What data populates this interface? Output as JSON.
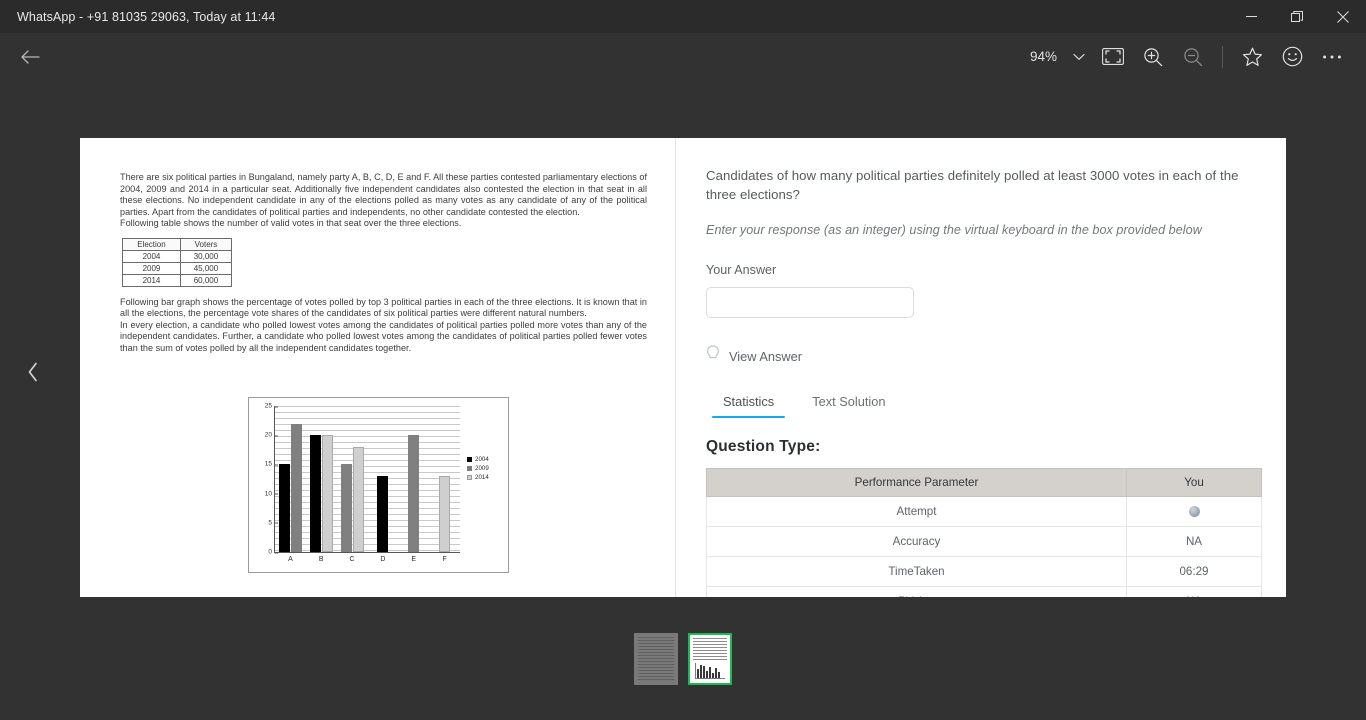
{
  "window": {
    "title": "WhatsApp - +91 81035 29063, Today at 11:44",
    "minimize_label": "Minimize",
    "restore_label": "Restore",
    "close_label": "Close"
  },
  "toolbar": {
    "back_label": "Back",
    "zoom_level": "94%",
    "zoom_dropdown_label": "Zoom options",
    "fit_label": "Fit to window",
    "zoom_in_label": "Zoom in",
    "zoom_out_label": "Zoom out",
    "favorite_label": "Add to favorites",
    "emoji_label": "React",
    "more_label": "More options"
  },
  "navigation": {
    "prev_label": "Previous"
  },
  "document": {
    "paragraph1": "There are six political parties in Bungaland, namely party A, B, C, D, E and F. All these parties contested parliamentary elections of 2004, 2009 and 2014 in a particular seat. Additionally five independent candidates also contested the election in that seat in all these elections. No independent candidate in any of the elections polled as many votes as any candidate of any of the political parties. Apart from the candidates of political parties and independents, no other candidate contested the election.",
    "paragraph1_last_line": "Following table shows the number of valid votes in that seat over the three elections.",
    "table": {
      "headers": [
        "Election",
        "Voters"
      ],
      "rows": [
        [
          "2004",
          "30,000"
        ],
        [
          "2009",
          "45,000"
        ],
        [
          "2014",
          "60,000"
        ]
      ]
    },
    "paragraph2": "Following bar graph shows the percentage of votes polled by top 3 political parties in each of the three elections.  It is known that in all the elections, the percentage vote shares of the candidates of six political parties were different natural numbers.",
    "paragraph3": "In every election, a candidate who polled lowest votes among the candidates of political parties polled more votes than any of the independent candidates.  Further, a candidate who polled lowest votes among the candidates of political parties polled fewer votes than the sum of votes polled by all the independent candidates together."
  },
  "chart_data": {
    "type": "bar",
    "title": "",
    "xlabel": "",
    "ylabel": "",
    "categories": [
      "A",
      "B",
      "C",
      "D",
      "E",
      "F"
    ],
    "yticks": [
      0,
      5,
      10,
      15,
      20,
      25
    ],
    "ylim": [
      0,
      25
    ],
    "grid": true,
    "legend_position": "right",
    "series": [
      {
        "name": "2004",
        "color": "#000000",
        "values": [
          15,
          20,
          null,
          13,
          null,
          null
        ]
      },
      {
        "name": "2009",
        "color": "#808080",
        "values": [
          22,
          null,
          15,
          null,
          20,
          null
        ]
      },
      {
        "name": "2014",
        "color": "#cfcfcf",
        "values": [
          null,
          20,
          18,
          null,
          null,
          13
        ]
      }
    ]
  },
  "question": {
    "text": "Candidates of how many political parties definitely polled at least 3000 votes in each of the three elections?",
    "instruction": "Enter your response (as an integer) using the virtual keyboard in the box provided below",
    "answer_label": "Your Answer",
    "answer_value": "",
    "answer_placeholder": "",
    "view_answer_label": "View Answer"
  },
  "tabs": [
    {
      "label": "Statistics",
      "active": true
    },
    {
      "label": "Text Solution",
      "active": false
    }
  ],
  "stats": {
    "section_title": "Question Type:",
    "headers": [
      "Performance Parameter",
      "You"
    ],
    "rows": [
      {
        "parameter": "Attempt",
        "value": "",
        "icon": "attempt-dot-icon"
      },
      {
        "parameter": "Accuracy",
        "value": "NA",
        "icon": ""
      },
      {
        "parameter": "TimeTaken",
        "value": "06:29",
        "icon": ""
      },
      {
        "parameter": "PValue",
        "value": "NA",
        "icon": ""
      }
    ]
  },
  "thumbnails": [
    {
      "label": "Page 1",
      "selected": false
    },
    {
      "label": "Page 2",
      "selected": true
    }
  ],
  "colors": {
    "accent": "#16a6f5",
    "selection": "#1db954",
    "chrome": "#323232",
    "titlebar": "#2b2b2b"
  }
}
